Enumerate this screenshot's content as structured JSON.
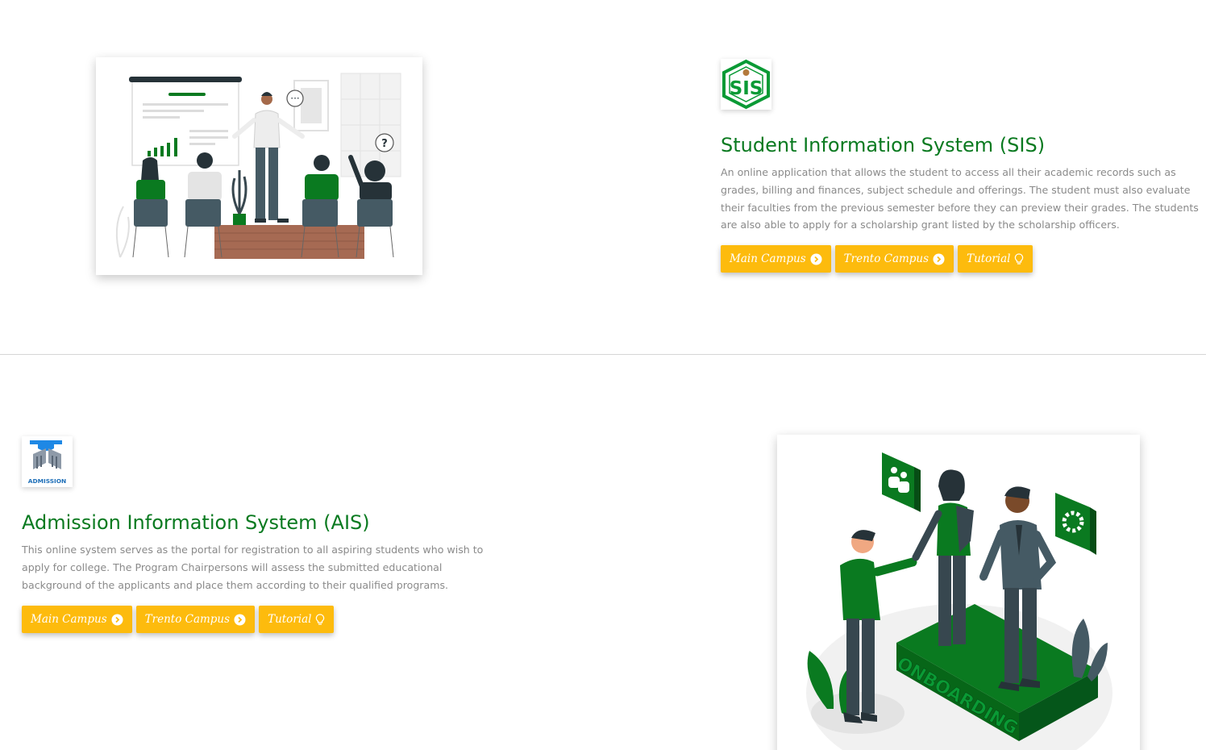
{
  "sis": {
    "title": "Student Information System (SIS)",
    "description": "An online application that allows the student to access all their academic records such as grades, billing and finances, subject schedule and offerings. The student must also evaluate their faculties from the previous semester before they can preview their grades. The students are also able to apply for a scholarship grant listed by the scholarship officers.",
    "logo_text": "SIS",
    "buttons": {
      "main": "Main Campus",
      "trento": "Trento Campus",
      "tutorial": "Tutorial"
    }
  },
  "ais": {
    "title": "Admission Information System (AIS)",
    "description": "This online system serves as the portal for registration to all aspiring students who wish to apply for college. The Program Chairpersons will assess the submitted educational background of the applicants and place them according to their qualified programs.",
    "logo_text": "ADMISSION",
    "illustration_text": "ONBOARDING",
    "buttons": {
      "main": "Main Campus",
      "trento": "Trento Campus",
      "tutorial": "Tutorial"
    }
  },
  "colors": {
    "accent": "#fdbb0d",
    "brand_green": "#0a7a20",
    "text_muted": "#8a8a8a"
  },
  "icons": {
    "campus": "chevron-circle-right-icon",
    "tutorial": "lightbulb-icon"
  }
}
